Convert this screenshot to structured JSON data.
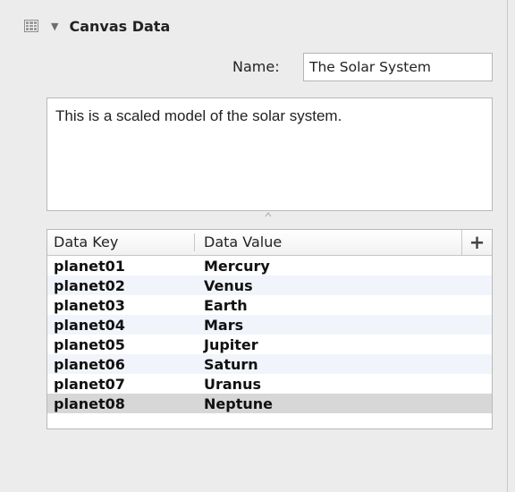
{
  "section": {
    "title": "Canvas Data",
    "table_icon": "table-icon",
    "disclosure_icon": "disclosure-triangle-down-icon"
  },
  "name_field": {
    "label": "Name:",
    "value": "The Solar System"
  },
  "description": {
    "value": "This is a scaled model of the solar system."
  },
  "data_table": {
    "columns": [
      "Data Key",
      "Data Value"
    ],
    "add_label": "+",
    "rows": [
      {
        "key": "planet01",
        "value": "Mercury"
      },
      {
        "key": "planet02",
        "value": "Venus"
      },
      {
        "key": "planet03",
        "value": "Earth"
      },
      {
        "key": "planet04",
        "value": "Mars"
      },
      {
        "key": "planet05",
        "value": "Jupiter"
      },
      {
        "key": "planet06",
        "value": "Saturn"
      },
      {
        "key": "planet07",
        "value": "Uranus"
      },
      {
        "key": "planet08",
        "value": "Neptune"
      }
    ],
    "selected_row": 7
  }
}
